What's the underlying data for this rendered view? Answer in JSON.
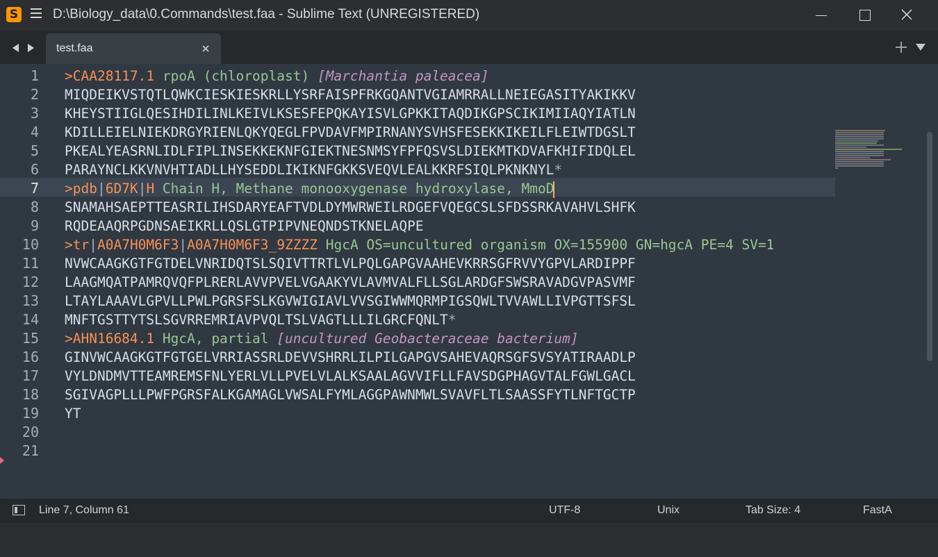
{
  "window": {
    "title": "D:\\Biology_data\\0.Commands\\test.faa - Sublime Text (UNREGISTERED)",
    "app_icon_glyph": "S"
  },
  "tabs": [
    {
      "label": "test.faa",
      "active": true
    }
  ],
  "editor": {
    "line_numbers": [
      "1",
      "2",
      "3",
      "4",
      "5",
      "6",
      "7",
      "8",
      "9",
      "10",
      "11",
      "12",
      "13",
      "14",
      "15",
      "16",
      "17",
      "18",
      "19",
      "20",
      "21"
    ],
    "active_line": 7,
    "lines": [
      [
        {
          "t": ">CAA28117.1",
          "c": "orange"
        },
        {
          "t": " rpoA (chloroplast) ",
          "c": "green"
        },
        {
          "t": "[Marchantia paleacea]",
          "c": "pink"
        }
      ],
      [
        {
          "t": "MIQDEIKVSTQTLQWKCIESKIESKRLLYSRFAISPFRKGQANTVGIAMRRALLNEIEGASITYAKIKKV",
          "c": "seq"
        }
      ],
      [
        {
          "t": "KHEYSTIIGLQESIHDILINLKEIVLKSESFEPQKAYISVLGPKKITAQDIKGPSCIKIMIIAQYIATLN",
          "c": "seq"
        }
      ],
      [
        {
          "t": "KDILLEIELNIEKDRGYRIENLQKYQEGLFPVDAVFMPIRNANYSVHSFESEKKIKEILFLEIWTDGSLT",
          "c": "seq"
        }
      ],
      [
        {
          "t": "PKEALYEASRNLIDLFIPLINSEKKEKNFGIEKTNESNMSYFPFQSVSLDIEKMTKDVAFKHIFIDQLEL",
          "c": "seq"
        }
      ],
      [
        {
          "t": "PARAYNCLKKVNVHTIADLLHYSEDDLIKIKNFGKKSVEQVLEALKKRFSIQLPKNKNYL",
          "c": "seq"
        },
        {
          "t": "*",
          "c": "star"
        }
      ],
      [
        {
          "t": ">pdb",
          "c": "orange"
        },
        {
          "t": "|",
          "c": "pipe"
        },
        {
          "t": "6D7K",
          "c": "orange"
        },
        {
          "t": "|",
          "c": "pipe"
        },
        {
          "t": "H",
          "c": "orange"
        },
        {
          "t": " Chain H, Methane monooxygenase hydroxylase, MmoD",
          "c": "green"
        },
        {
          "t": "",
          "c": "cursor"
        }
      ],
      [
        {
          "t": "SNAMAHSAEPTTEASRILIHSDARYEAFTVDLDYMWRWEILRDGEFVQEGCSLSFDSSRKAVAHVLSHFK",
          "c": "seq"
        }
      ],
      [
        {
          "t": "RQDEAAQRPGDNSAEIKRLLQSLGTPIPVNEQNDSTKNELAQPE",
          "c": "seq"
        }
      ],
      [
        {
          "t": ">tr",
          "c": "orange"
        },
        {
          "t": "|",
          "c": "pipe"
        },
        {
          "t": "A0A7H0M6F3",
          "c": "orange"
        },
        {
          "t": "|",
          "c": "pipe"
        },
        {
          "t": "A0A7H0M6F3_9ZZZZ",
          "c": "orange"
        },
        {
          "t": " HgcA OS=uncultured organism OX=155900 GN=hgcA PE=4 SV=1",
          "c": "green"
        }
      ],
      [
        {
          "t": "NVWCAAGKGTFGTDELVNRIDQTSLSQIVTTRTLVLPQLGAPGVAAHEVKRRSGFRVVYGPVLARDIPPF",
          "c": "seq"
        }
      ],
      [
        {
          "t": "LAAGMQATPAMRQVQFPLRERLAVVPVELVGAAKYVLAVMVALFLLSGLARDGFSWSRAVADGVPASVMF",
          "c": "seq"
        }
      ],
      [
        {
          "t": "LTAYLAAAVLGPVLLPWLPGRSFSLKGVWIGIAVLVVSGIWWMQRMPIGSQWLTVVAWLLIVPGTTSFSL",
          "c": "seq"
        }
      ],
      [
        {
          "t": "MNFTGSTTYTSLSGVRREMRIAVPVQLTSLVAGTLLLILGRCFQNLT",
          "c": "seq"
        },
        {
          "t": "*",
          "c": "star"
        }
      ],
      [
        {
          "t": ">AHN16684.1",
          "c": "orange"
        },
        {
          "t": " HgcA, partial ",
          "c": "green"
        },
        {
          "t": "[uncultured Geobacteraceae bacterium]",
          "c": "pink"
        }
      ],
      [
        {
          "t": "GINVWCAAGKGTFGTGELVRRIASSRLDEVVSHRRLILPILGAPGVSAHEVAQRSGFSVSYATIRAADLP",
          "c": "seq"
        }
      ],
      [
        {
          "t": "VYLDNDMVTTEAMREMSFNLYERLVLLPVELVLALKSAALAGVVIFLLFAVSDGPHAGVTALFGWLGACL",
          "c": "seq"
        }
      ],
      [
        {
          "t": "SGIVAGPLLLPWFPGRSFALKGAMAGLVWSALFYMLAGGPAWNMWLSVAVFLTLSAASSFYTLNFTGCTP",
          "c": "seq"
        }
      ],
      [
        {
          "t": "YT",
          "c": "seq"
        }
      ],
      [],
      []
    ]
  },
  "statusbar": {
    "position": "Line 7, Column 61",
    "encoding": "UTF-8",
    "line_endings": "Unix",
    "tab_size": "Tab Size: 4",
    "syntax": "FastA"
  },
  "colors": {
    "background": "#303841",
    "accent_orange": "#f99157",
    "accent_green": "#99c794",
    "accent_pink": "#c594c5",
    "sequence_text": "#d8dee9",
    "cursor": "#f9ae58"
  },
  "icons": {
    "menu": "hamburger-menu-icon",
    "nav_left": "triangle-left-icon",
    "nav_right": "triangle-right-icon",
    "tab_close": "close-icon",
    "new_tab": "plus-icon",
    "tab_list": "triangle-down-icon",
    "sidebar_toggle": "panel-icon"
  }
}
